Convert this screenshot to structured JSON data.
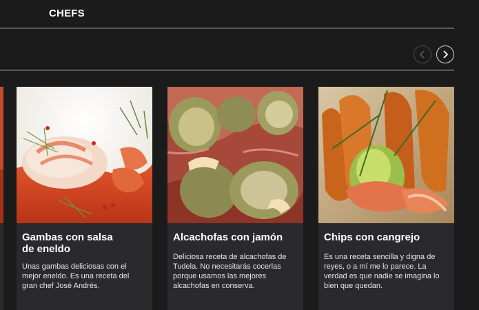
{
  "header": {
    "title": "CHEFS"
  },
  "carousel": {
    "prev_icon": "chevron-left-icon",
    "next_icon": "chevron-right-icon",
    "cards": [
      {
        "title_line1": "Gambas con salsa",
        "title_line2": "de eneldo",
        "desc_line1": "Unas gambas deliciosas con el",
        "desc_line2": "mejor eneldo. Es una receta del",
        "desc_line3": "gran chef  José Andrés."
      },
      {
        "title_line1": "Alcachofas con jamón",
        "desc_line1": "Deliciosa receta  de alcachofas de",
        "desc_line2": "Tudela. No necesitarás cocerlas",
        "desc_line3": "porque usamos las mejores",
        "desc_line4": "alcachofas en conserva."
      },
      {
        "title_line1": "Chips con cangrejo",
        "desc_line1": "Es una receta sencilla y digna de",
        "desc_line2": "reyes, o a mí me lo parece. La",
        "desc_line3": "verdad es que nadie se imagina lo",
        "desc_line4": "bien que quedan."
      }
    ]
  },
  "colors": {
    "background": "#1b1b1c",
    "card": "#2a2a2c",
    "rule": "#5c5c5d"
  }
}
